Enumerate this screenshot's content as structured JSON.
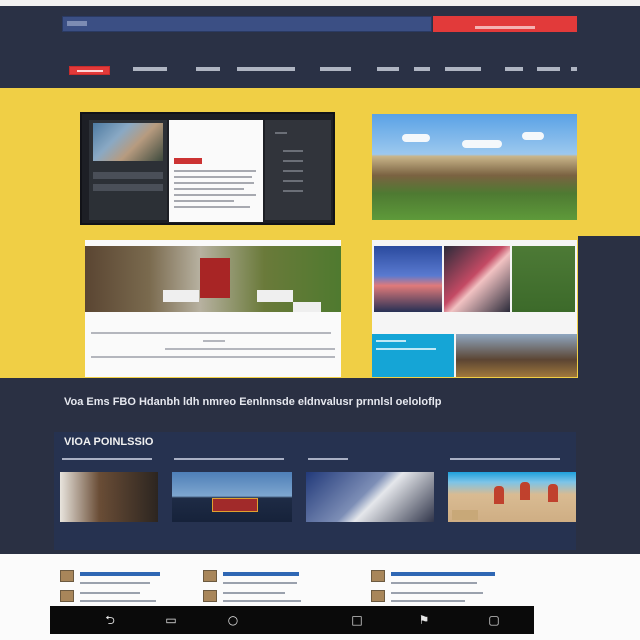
{
  "headline": "Voa Ems FBO Hdanbh ldh nmreo Eenlnnsde eldnvalusr prnnlsl oeloloflp",
  "video_section": {
    "title": "VIOA POINLSSIO"
  },
  "colors": {
    "header_bg": "#2a3145",
    "accent": "#e23a3a",
    "feature_band": "#f0cf45",
    "search_bar": "#3b4f84",
    "body_bg": "#2a3043"
  },
  "icons": {
    "sysbar": [
      "back-icon",
      "home-icon",
      "refresh-icon",
      "square-icon",
      "flag-icon",
      "window-icon"
    ]
  }
}
